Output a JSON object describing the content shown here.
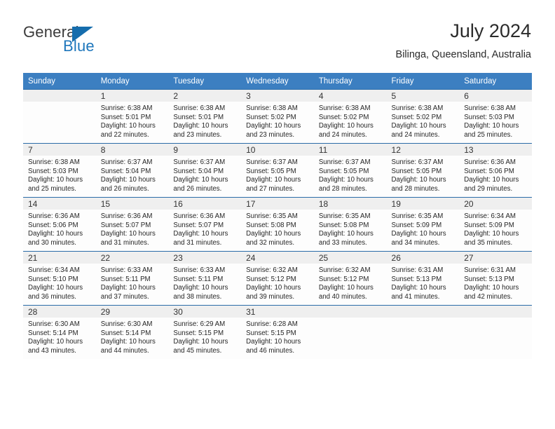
{
  "brand": {
    "name_part1": "General",
    "name_part2": "Blue",
    "triangle_icon": "blue-triangle-icon",
    "colors": {
      "general_text": "#3b3b3b",
      "blue_text": "#1f77bc",
      "triangle": "#156dad"
    }
  },
  "header": {
    "title": "July 2024",
    "subtitle": "Bilinga, Queensland, Australia"
  },
  "calendar": {
    "accent_color": "#3c7fc1",
    "grid_line_color": "#2a6ca8",
    "daynum_band_color": "#efefef",
    "weekdays": [
      "Sunday",
      "Monday",
      "Tuesday",
      "Wednesday",
      "Thursday",
      "Friday",
      "Saturday"
    ],
    "weeks": [
      [
        {
          "day": "",
          "sunrise": "",
          "sunset": "",
          "daylight_line1": "",
          "daylight_line2": ""
        },
        {
          "day": "1",
          "sunrise": "Sunrise: 6:38 AM",
          "sunset": "Sunset: 5:01 PM",
          "daylight_line1": "Daylight: 10 hours",
          "daylight_line2": "and 22 minutes."
        },
        {
          "day": "2",
          "sunrise": "Sunrise: 6:38 AM",
          "sunset": "Sunset: 5:01 PM",
          "daylight_line1": "Daylight: 10 hours",
          "daylight_line2": "and 23 minutes."
        },
        {
          "day": "3",
          "sunrise": "Sunrise: 6:38 AM",
          "sunset": "Sunset: 5:02 PM",
          "daylight_line1": "Daylight: 10 hours",
          "daylight_line2": "and 23 minutes."
        },
        {
          "day": "4",
          "sunrise": "Sunrise: 6:38 AM",
          "sunset": "Sunset: 5:02 PM",
          "daylight_line1": "Daylight: 10 hours",
          "daylight_line2": "and 24 minutes."
        },
        {
          "day": "5",
          "sunrise": "Sunrise: 6:38 AM",
          "sunset": "Sunset: 5:02 PM",
          "daylight_line1": "Daylight: 10 hours",
          "daylight_line2": "and 24 minutes."
        },
        {
          "day": "6",
          "sunrise": "Sunrise: 6:38 AM",
          "sunset": "Sunset: 5:03 PM",
          "daylight_line1": "Daylight: 10 hours",
          "daylight_line2": "and 25 minutes."
        }
      ],
      [
        {
          "day": "7",
          "sunrise": "Sunrise: 6:38 AM",
          "sunset": "Sunset: 5:03 PM",
          "daylight_line1": "Daylight: 10 hours",
          "daylight_line2": "and 25 minutes."
        },
        {
          "day": "8",
          "sunrise": "Sunrise: 6:37 AM",
          "sunset": "Sunset: 5:04 PM",
          "daylight_line1": "Daylight: 10 hours",
          "daylight_line2": "and 26 minutes."
        },
        {
          "day": "9",
          "sunrise": "Sunrise: 6:37 AM",
          "sunset": "Sunset: 5:04 PM",
          "daylight_line1": "Daylight: 10 hours",
          "daylight_line2": "and 26 minutes."
        },
        {
          "day": "10",
          "sunrise": "Sunrise: 6:37 AM",
          "sunset": "Sunset: 5:05 PM",
          "daylight_line1": "Daylight: 10 hours",
          "daylight_line2": "and 27 minutes."
        },
        {
          "day": "11",
          "sunrise": "Sunrise: 6:37 AM",
          "sunset": "Sunset: 5:05 PM",
          "daylight_line1": "Daylight: 10 hours",
          "daylight_line2": "and 28 minutes."
        },
        {
          "day": "12",
          "sunrise": "Sunrise: 6:37 AM",
          "sunset": "Sunset: 5:05 PM",
          "daylight_line1": "Daylight: 10 hours",
          "daylight_line2": "and 28 minutes."
        },
        {
          "day": "13",
          "sunrise": "Sunrise: 6:36 AM",
          "sunset": "Sunset: 5:06 PM",
          "daylight_line1": "Daylight: 10 hours",
          "daylight_line2": "and 29 minutes."
        }
      ],
      [
        {
          "day": "14",
          "sunrise": "Sunrise: 6:36 AM",
          "sunset": "Sunset: 5:06 PM",
          "daylight_line1": "Daylight: 10 hours",
          "daylight_line2": "and 30 minutes."
        },
        {
          "day": "15",
          "sunrise": "Sunrise: 6:36 AM",
          "sunset": "Sunset: 5:07 PM",
          "daylight_line1": "Daylight: 10 hours",
          "daylight_line2": "and 31 minutes."
        },
        {
          "day": "16",
          "sunrise": "Sunrise: 6:36 AM",
          "sunset": "Sunset: 5:07 PM",
          "daylight_line1": "Daylight: 10 hours",
          "daylight_line2": "and 31 minutes."
        },
        {
          "day": "17",
          "sunrise": "Sunrise: 6:35 AM",
          "sunset": "Sunset: 5:08 PM",
          "daylight_line1": "Daylight: 10 hours",
          "daylight_line2": "and 32 minutes."
        },
        {
          "day": "18",
          "sunrise": "Sunrise: 6:35 AM",
          "sunset": "Sunset: 5:08 PM",
          "daylight_line1": "Daylight: 10 hours",
          "daylight_line2": "and 33 minutes."
        },
        {
          "day": "19",
          "sunrise": "Sunrise: 6:35 AM",
          "sunset": "Sunset: 5:09 PM",
          "daylight_line1": "Daylight: 10 hours",
          "daylight_line2": "and 34 minutes."
        },
        {
          "day": "20",
          "sunrise": "Sunrise: 6:34 AM",
          "sunset": "Sunset: 5:09 PM",
          "daylight_line1": "Daylight: 10 hours",
          "daylight_line2": "and 35 minutes."
        }
      ],
      [
        {
          "day": "21",
          "sunrise": "Sunrise: 6:34 AM",
          "sunset": "Sunset: 5:10 PM",
          "daylight_line1": "Daylight: 10 hours",
          "daylight_line2": "and 36 minutes."
        },
        {
          "day": "22",
          "sunrise": "Sunrise: 6:33 AM",
          "sunset": "Sunset: 5:11 PM",
          "daylight_line1": "Daylight: 10 hours",
          "daylight_line2": "and 37 minutes."
        },
        {
          "day": "23",
          "sunrise": "Sunrise: 6:33 AM",
          "sunset": "Sunset: 5:11 PM",
          "daylight_line1": "Daylight: 10 hours",
          "daylight_line2": "and 38 minutes."
        },
        {
          "day": "24",
          "sunrise": "Sunrise: 6:32 AM",
          "sunset": "Sunset: 5:12 PM",
          "daylight_line1": "Daylight: 10 hours",
          "daylight_line2": "and 39 minutes."
        },
        {
          "day": "25",
          "sunrise": "Sunrise: 6:32 AM",
          "sunset": "Sunset: 5:12 PM",
          "daylight_line1": "Daylight: 10 hours",
          "daylight_line2": "and 40 minutes."
        },
        {
          "day": "26",
          "sunrise": "Sunrise: 6:31 AM",
          "sunset": "Sunset: 5:13 PM",
          "daylight_line1": "Daylight: 10 hours",
          "daylight_line2": "and 41 minutes."
        },
        {
          "day": "27",
          "sunrise": "Sunrise: 6:31 AM",
          "sunset": "Sunset: 5:13 PM",
          "daylight_line1": "Daylight: 10 hours",
          "daylight_line2": "and 42 minutes."
        }
      ],
      [
        {
          "day": "28",
          "sunrise": "Sunrise: 6:30 AM",
          "sunset": "Sunset: 5:14 PM",
          "daylight_line1": "Daylight: 10 hours",
          "daylight_line2": "and 43 minutes."
        },
        {
          "day": "29",
          "sunrise": "Sunrise: 6:30 AM",
          "sunset": "Sunset: 5:14 PM",
          "daylight_line1": "Daylight: 10 hours",
          "daylight_line2": "and 44 minutes."
        },
        {
          "day": "30",
          "sunrise": "Sunrise: 6:29 AM",
          "sunset": "Sunset: 5:15 PM",
          "daylight_line1": "Daylight: 10 hours",
          "daylight_line2": "and 45 minutes."
        },
        {
          "day": "31",
          "sunrise": "Sunrise: 6:28 AM",
          "sunset": "Sunset: 5:15 PM",
          "daylight_line1": "Daylight: 10 hours",
          "daylight_line2": "and 46 minutes."
        },
        {
          "day": "",
          "sunrise": "",
          "sunset": "",
          "daylight_line1": "",
          "daylight_line2": ""
        },
        {
          "day": "",
          "sunrise": "",
          "sunset": "",
          "daylight_line1": "",
          "daylight_line2": ""
        },
        {
          "day": "",
          "sunrise": "",
          "sunset": "",
          "daylight_line1": "",
          "daylight_line2": ""
        }
      ]
    ]
  }
}
